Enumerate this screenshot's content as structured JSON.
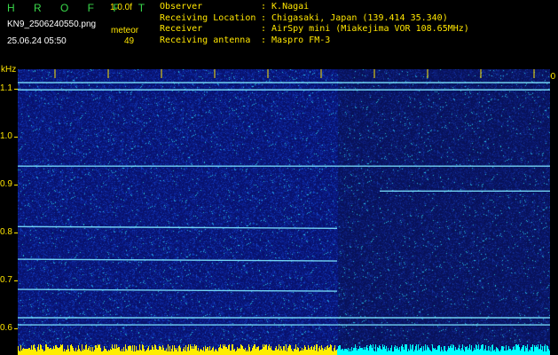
{
  "header": {
    "brand": "H R O F F T",
    "version": "1.0.0f",
    "filename": "KN9_2506240550.png",
    "datetime": "25.06.24 05:50",
    "meteor_label": "meteor",
    "meteor_count": "49"
  },
  "station": [
    {
      "label": "Observer",
      "value": ": K.Nagai"
    },
    {
      "label": "Receiving Location",
      "value": ": Chigasaki, Japan (139.414 35.340)"
    },
    {
      "label": "Receiver",
      "value": ": AirSpy mini (Miakejima VOR 108.65MHz)"
    },
    {
      "label": "Receiving antenna",
      "value": ": Maspro FM-3"
    }
  ],
  "axis": {
    "unit": "kHz",
    "y_ticks": [
      "1.1",
      "1.0",
      "0.9",
      "0.8",
      "0.7",
      "0.6"
    ],
    "y_range": [
      0.585,
      1.14
    ],
    "x_ticks": [
      "0551",
      "0552",
      "0553",
      "0554",
      "0555",
      "0556",
      "0557",
      "0558",
      "0559",
      "0600"
    ]
  },
  "colors": {
    "background": "#0a1a8c",
    "text": "#ffe600",
    "brand": "#39d94a",
    "trace": "#7fe7ff",
    "histogram_yellow": "#ffee00",
    "histogram_cyan": "#00ffff"
  },
  "traces": [
    {
      "freq_khz": 1.112,
      "start": 0,
      "end": 1
    },
    {
      "freq_khz": 1.097,
      "start": 0,
      "end": 1
    },
    {
      "freq_khz": 0.938,
      "start": 0,
      "end": 1
    },
    {
      "freq_khz": 0.886,
      "start": 0.68,
      "end": 1
    },
    {
      "freq_khz": 0.812,
      "start": 0,
      "end": 0.6
    },
    {
      "freq_khz": 0.744,
      "start": 0,
      "end": 0.6
    },
    {
      "freq_khz": 0.681,
      "start": 0,
      "end": 0.6
    },
    {
      "freq_khz": 0.622,
      "start": 0,
      "end": 1
    },
    {
      "freq_khz": 0.607,
      "start": 0,
      "end": 1
    }
  ]
}
